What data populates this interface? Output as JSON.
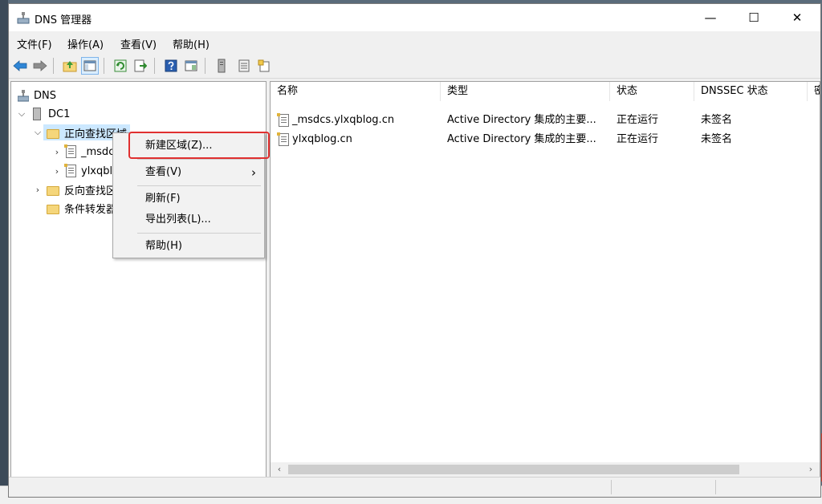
{
  "window": {
    "title": "DNS 管理器",
    "minimize_glyph": "—",
    "maximize_glyph": "☐",
    "close_glyph": "✕"
  },
  "menu": {
    "file": "文件(F)",
    "action": "操作(A)",
    "view": "查看(V)",
    "help": "帮助(H)"
  },
  "toolbar": {
    "icons": [
      "back-arrow-icon",
      "forward-arrow-icon",
      "up-folder-icon",
      "show-hide-tree-icon",
      "refresh-icon",
      "export-list-icon",
      "help-icon",
      "properties-icon",
      "server-icon",
      "list-icon",
      "new-zone-icon"
    ]
  },
  "tree": {
    "root": "DNS",
    "server": "DC1",
    "forward_zones": "正向查找区域",
    "zone1": "_msdcs.ylxqblog.cn",
    "zone2": "ylxqblog.cn",
    "reverse_zones": "反向查找区域",
    "conditional": "条件转发器"
  },
  "list": {
    "columns": [
      "名称",
      "类型",
      "状态",
      "DNSSEC 状态",
      "密"
    ],
    "rows": [
      {
        "name": "_msdcs.ylxqblog.cn",
        "type": "Active Directory 集成的主要...",
        "status": "正在运行",
        "dnssec": "未签名"
      },
      {
        "name": "ylxqblog.cn",
        "type": "Active Directory 集成的主要...",
        "status": "正在运行",
        "dnssec": "未签名"
      }
    ]
  },
  "context_menu": {
    "new_zone": "新建区域(Z)...",
    "view": "查看(V)",
    "submenu_arrow": "›",
    "refresh": "刷新(F)",
    "export": "导出列表(L)...",
    "help": "帮助(H)"
  },
  "colors": {
    "highlight": "#e03030",
    "selection": "#cce8ff",
    "folder": "#f5d67b"
  }
}
